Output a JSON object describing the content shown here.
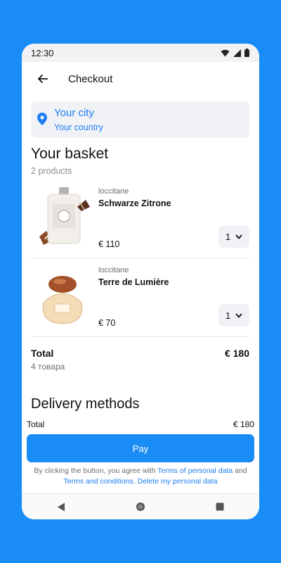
{
  "status_bar": {
    "time": "12:30"
  },
  "header": {
    "title": "Checkout"
  },
  "location": {
    "city": "Your city",
    "country": "Your country"
  },
  "basket": {
    "title": "Your basket",
    "count": "2 products",
    "items": [
      {
        "brand": "loccitane",
        "name": "Schwarze Zitrone",
        "price": "€ 110",
        "qty": "1"
      },
      {
        "brand": "loccitane",
        "name": "Terre de Lumière",
        "price": "€ 70",
        "qty": "1"
      }
    ],
    "total_label": "Total",
    "total_value": "€ 180",
    "total_count": "4 товара"
  },
  "delivery": {
    "title": "Delivery methods"
  },
  "summary": {
    "total_label": "Total",
    "total_value": "€ 180"
  },
  "pay": {
    "label": "Pay"
  },
  "legal": {
    "prefix": "By clicking the button, you agree with ",
    "link1": "Terms of personal data",
    "and": " and ",
    "link2": "Terms and conditions.",
    "space": " ",
    "link3": "Delete my personal data"
  },
  "colors": {
    "accent": "#1a8cf5",
    "link": "#1f7ef3",
    "background": "#1a8cf5"
  }
}
